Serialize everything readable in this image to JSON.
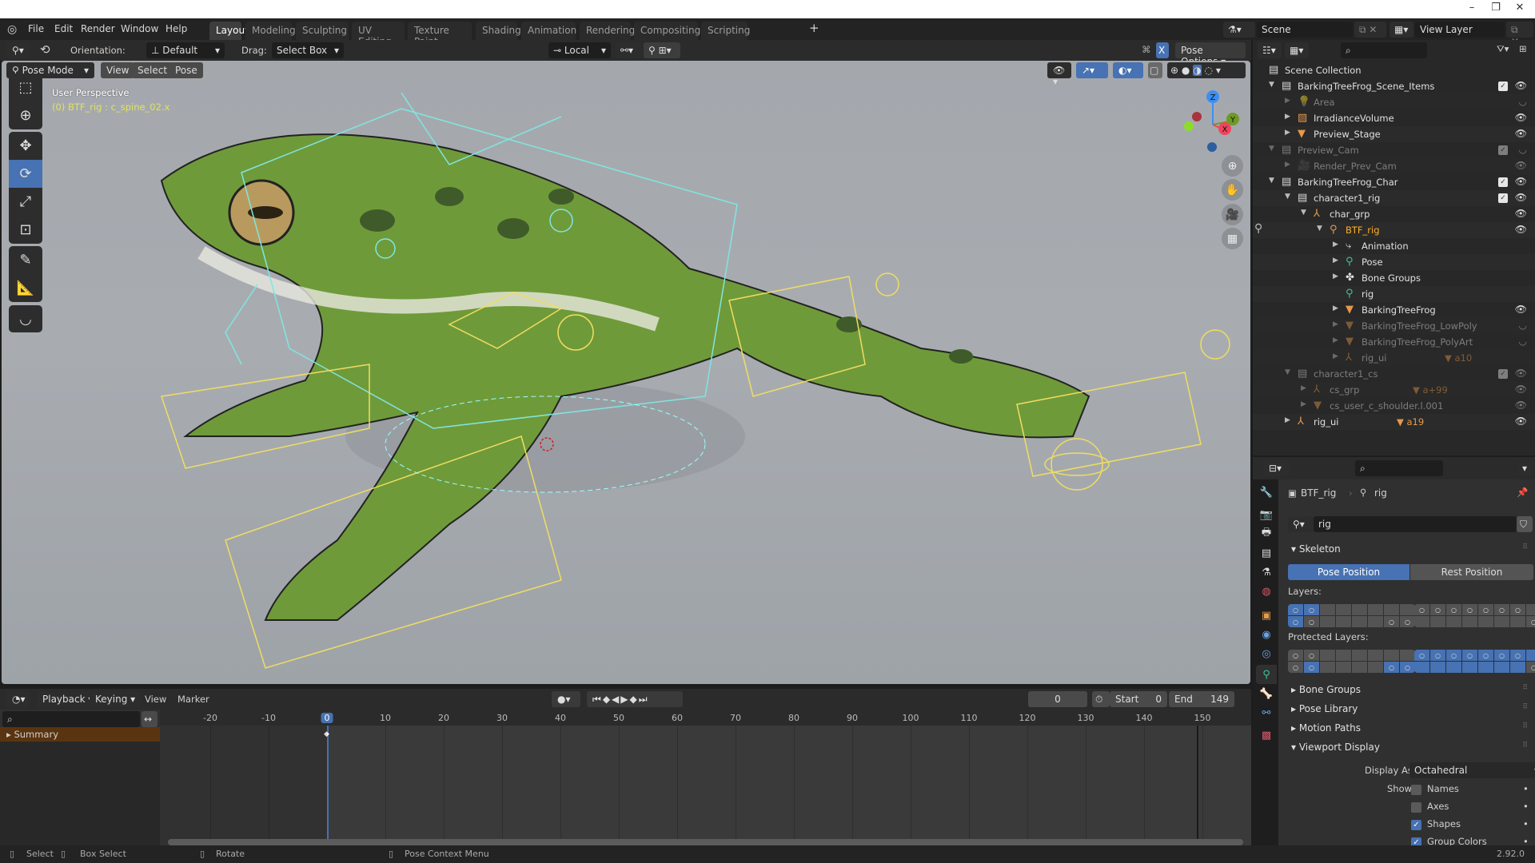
{
  "app": {
    "version": "2.92.0"
  },
  "window_controls": {
    "minimize": "–",
    "maximize": "❐",
    "close": "✕"
  },
  "menu": [
    "File",
    "Edit",
    "Render",
    "Window",
    "Help"
  ],
  "workspaces": [
    "Layout",
    "Modeling",
    "Sculpting",
    "UV Editing",
    "Texture Paint",
    "Shading",
    "Animation",
    "Rendering",
    "Compositing",
    "Scripting"
  ],
  "active_workspace": "Layout",
  "scene": {
    "name": "Scene",
    "view_layer": "View Layer"
  },
  "tool_header": {
    "orientation_label": "Orientation:",
    "orientation_value": "Default",
    "drag_label": "Drag:",
    "drag_value": "Select Box",
    "pivot_value": "Local",
    "x_mirror": "X",
    "pose_options": "Pose Options"
  },
  "viewport_header": {
    "mode": "Pose Mode",
    "menus": [
      "View",
      "Select",
      "Pose"
    ]
  },
  "viewport": {
    "view_name": "User Perspective",
    "active_info": "(0) BTF_rig : c_spine_02.x",
    "gizmo_axes": {
      "z": "Z",
      "y": "Y",
      "x": "X"
    },
    "axis_colors": {
      "x": "#f0445c",
      "y": "#6f9a24",
      "z": "#3d8ef2"
    }
  },
  "outliner": {
    "root": "Scene Collection",
    "rows": [
      {
        "label": "BarkingTreeFrog_Scene_Items",
        "depth": 1,
        "expanded": true,
        "type": "collection",
        "check": true,
        "eye": true
      },
      {
        "label": "Area",
        "depth": 2,
        "type": "light",
        "dim": true,
        "eye": false
      },
      {
        "label": "IrradianceVolume",
        "depth": 2,
        "type": "lightprobe",
        "eye": true
      },
      {
        "label": "Preview_Stage",
        "depth": 2,
        "type": "mesh",
        "eye": true
      },
      {
        "label": "Preview_Cam",
        "depth": 1,
        "expanded": true,
        "type": "collection",
        "dim": true,
        "check": true,
        "eye": false
      },
      {
        "label": "Render_Prev_Cam",
        "depth": 2,
        "type": "camera",
        "dim": true,
        "eye": true
      },
      {
        "label": "BarkingTreeFrog_Char",
        "depth": 1,
        "expanded": true,
        "type": "collection",
        "check": true,
        "eye": true
      },
      {
        "label": "character1_rig",
        "depth": 2,
        "expanded": true,
        "type": "collection",
        "check": true,
        "eye": true
      },
      {
        "label": "char_grp",
        "depth": 3,
        "expanded": true,
        "type": "empty",
        "eye": true
      },
      {
        "label": "BTF_rig",
        "depth": 4,
        "expanded": true,
        "type": "armature",
        "active": true,
        "eye": true
      },
      {
        "label": "Animation",
        "depth": 5,
        "type": "animation"
      },
      {
        "label": "Pose",
        "depth": 5,
        "type": "pose"
      },
      {
        "label": "Bone Groups",
        "depth": 5,
        "type": "bonegroups"
      },
      {
        "label": "rig",
        "depth": 5,
        "type": "armature-data",
        "noarrow": true
      },
      {
        "label": "BarkingTreeFrog",
        "depth": 5,
        "type": "mesh",
        "eye": true
      },
      {
        "label": "BarkingTreeFrog_LowPoly",
        "depth": 5,
        "type": "mesh",
        "dim": true,
        "eye": false
      },
      {
        "label": "BarkingTreeFrog_PolyArt",
        "depth": 5,
        "type": "mesh",
        "dim": true,
        "eye": false
      },
      {
        "label": "rig_ui",
        "depth": 5,
        "type": "empty",
        "dim": true,
        "badge": "10"
      },
      {
        "label": "character1_cs",
        "depth": 2,
        "expanded": true,
        "type": "collection",
        "dim": true,
        "check": true,
        "eye": true
      },
      {
        "label": "cs_grp",
        "depth": 3,
        "type": "empty",
        "dim": true,
        "badge": "+99",
        "eye": true
      },
      {
        "label": "cs_user_c_shoulder.l.001",
        "depth": 3,
        "type": "mesh",
        "dim": true,
        "eye": true
      },
      {
        "label": "rig_ui",
        "depth": 2,
        "type": "empty",
        "badge": "19",
        "eye": true
      }
    ]
  },
  "properties": {
    "breadcrumb": {
      "object": "BTF_rig",
      "data": "rig"
    },
    "datablock_name": "rig",
    "skeleton": {
      "title": "Skeleton",
      "pose_position": "Pose Position",
      "rest_position": "Rest Position",
      "layers_label": "Layers:",
      "protected_layers_label": "Protected Layers:"
    },
    "layers": {
      "left_top": [
        [
          1,
          1
        ],
        [
          1,
          1
        ],
        [
          0,
          0
        ],
        [
          0,
          0
        ],
        [
          0,
          0
        ],
        [
          0,
          0
        ],
        [
          0,
          0
        ],
        [
          0,
          0
        ]
      ],
      "left_bottom": [
        [
          1,
          1
        ],
        [
          0,
          1
        ],
        [
          0,
          0
        ],
        [
          0,
          0
        ],
        [
          0,
          0
        ],
        [
          0,
          0
        ],
        [
          0,
          1
        ],
        [
          0,
          1
        ]
      ],
      "right_top": [
        [
          0,
          1
        ],
        [
          0,
          1
        ],
        [
          0,
          1
        ],
        [
          0,
          1
        ],
        [
          0,
          1
        ],
        [
          0,
          1
        ],
        [
          0,
          1
        ],
        [
          0,
          0
        ]
      ],
      "right_bottom": [
        [
          0,
          0
        ],
        [
          0,
          0
        ],
        [
          0,
          0
        ],
        [
          0,
          0
        ],
        [
          0,
          0
        ],
        [
          0,
          0
        ],
        [
          0,
          0
        ],
        [
          0,
          1
        ]
      ]
    },
    "protected_layers": {
      "left_top": [
        [
          0,
          1
        ],
        [
          0,
          1
        ],
        [
          0,
          0
        ],
        [
          0,
          0
        ],
        [
          0,
          0
        ],
        [
          0,
          0
        ],
        [
          0,
          0
        ],
        [
          0,
          0
        ]
      ],
      "left_bottom": [
        [
          0,
          1
        ],
        [
          1,
          1
        ],
        [
          0,
          0
        ],
        [
          0,
          0
        ],
        [
          0,
          0
        ],
        [
          0,
          0
        ],
        [
          1,
          1
        ],
        [
          1,
          1
        ]
      ],
      "right_top": [
        [
          1,
          1
        ],
        [
          1,
          1
        ],
        [
          1,
          1
        ],
        [
          1,
          1
        ],
        [
          1,
          1
        ],
        [
          1,
          1
        ],
        [
          1,
          1
        ],
        [
          1,
          0
        ]
      ],
      "right_bottom": [
        [
          1,
          0
        ],
        [
          1,
          0
        ],
        [
          1,
          0
        ],
        [
          1,
          0
        ],
        [
          1,
          0
        ],
        [
          1,
          0
        ],
        [
          1,
          0
        ],
        [
          0,
          1
        ]
      ]
    },
    "panels": [
      "Bone Groups",
      "Pose Library",
      "Motion Paths",
      "Viewport Display"
    ],
    "viewport_display": {
      "display_as_label": "Display As",
      "display_as_value": "Octahedral",
      "show_label": "Show",
      "options": [
        {
          "label": "Names",
          "checked": false
        },
        {
          "label": "Axes",
          "checked": false
        },
        {
          "label": "Shapes",
          "checked": true
        },
        {
          "label": "Group Colors",
          "checked": true
        }
      ]
    }
  },
  "timeline": {
    "menus": [
      "Playback",
      "Keying",
      "View",
      "Marker"
    ],
    "current_frame": "0",
    "start_label": "Start",
    "start": "0",
    "end_label": "End",
    "end": "149",
    "ticks": [
      "-20",
      "-10",
      "0",
      "10",
      "20",
      "30",
      "40",
      "50",
      "60",
      "70",
      "80",
      "90",
      "100",
      "110",
      "120",
      "130",
      "140",
      "150"
    ],
    "channel": "Summary"
  },
  "statusbar": {
    "select": "Select",
    "box_select": "Box Select",
    "rotate": "Rotate",
    "context_menu": "Pose Context Menu",
    "version": "2.92.0"
  },
  "colors": {
    "accent": "#4772b3",
    "summary": "#5a3410",
    "active_text": "#ffaf29"
  }
}
